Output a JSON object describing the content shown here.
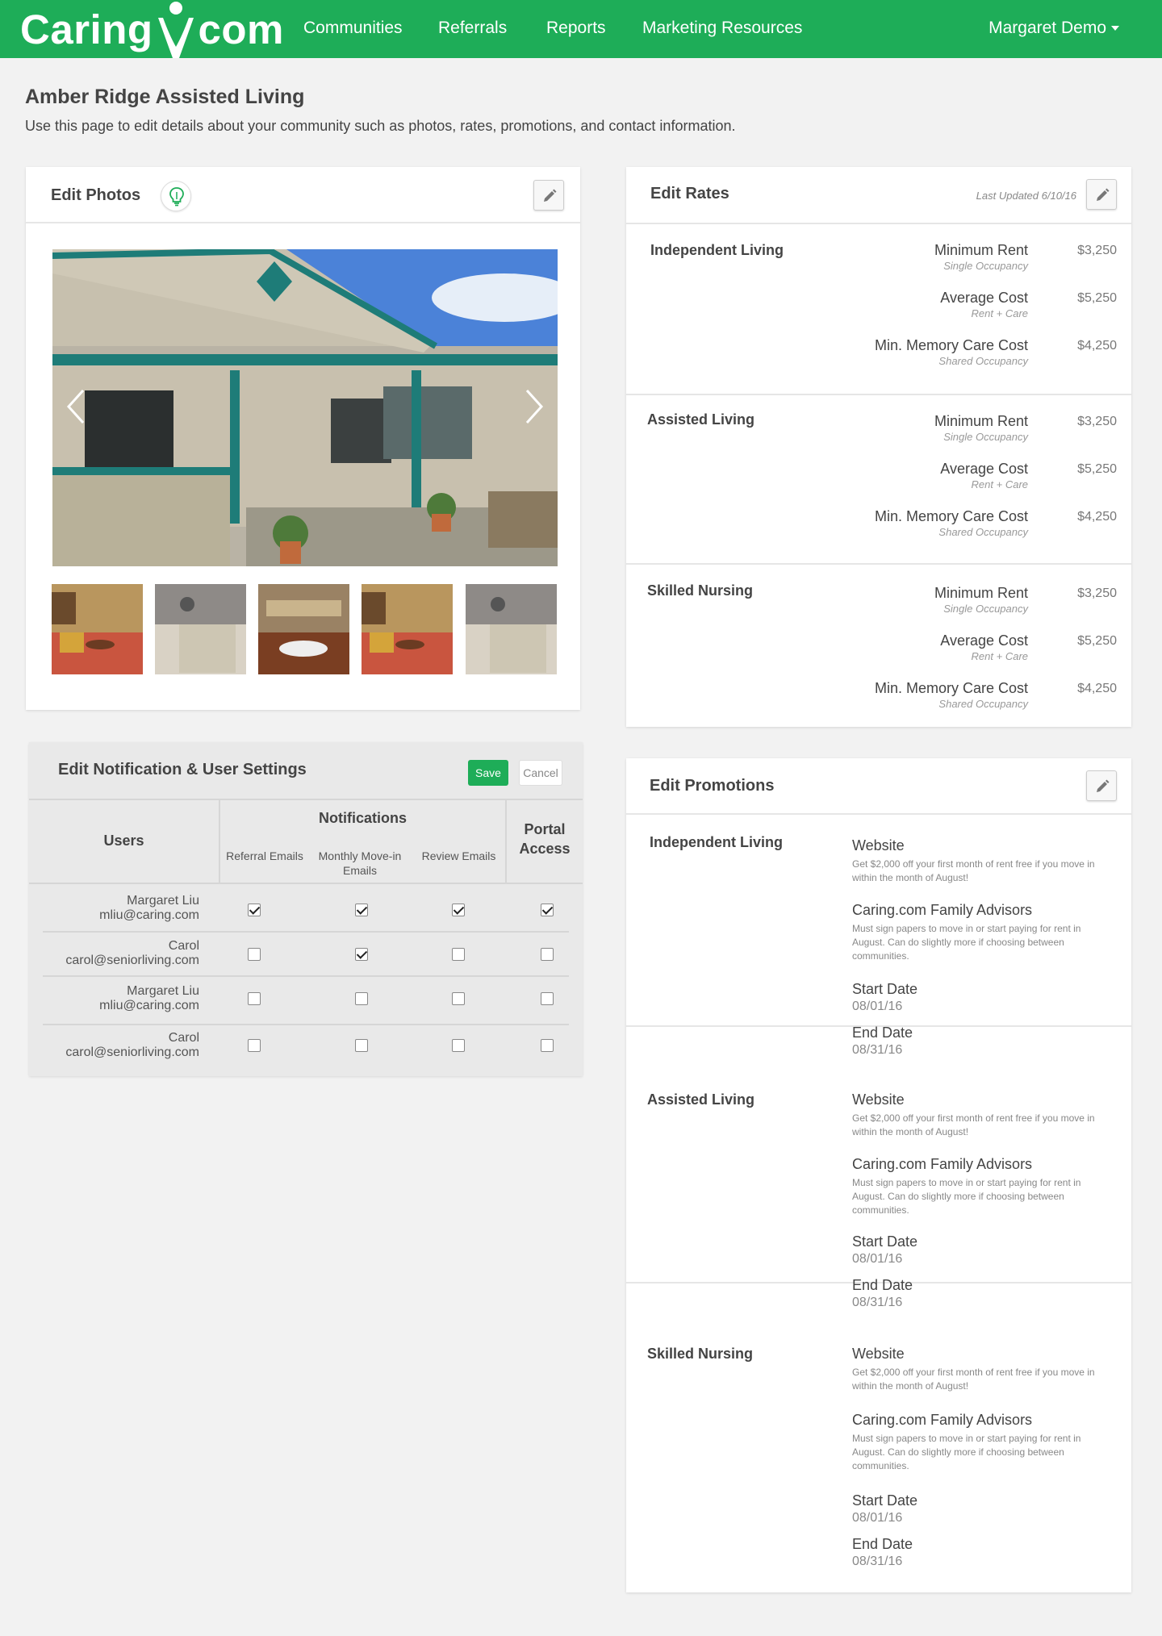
{
  "nav": {
    "logo_left": "Caring",
    "logo_right": "com",
    "links": [
      "Communities",
      "Referrals",
      "Reports",
      "Marketing Resources"
    ],
    "user": "Margaret Demo"
  },
  "page": {
    "title": "Amber Ridge Assisted Living",
    "description": "Use this page to edit details about your community such as photos, rates, promotions, and contact information."
  },
  "photos": {
    "title": "Edit Photos",
    "thumbnail_count": 5
  },
  "rates": {
    "title": "Edit Rates",
    "last_updated": "Last Updated 6/10/16",
    "sections": [
      {
        "category": "Independent Living",
        "rows": [
          {
            "label": "Minimum Rent",
            "sub": "Single Occupancy",
            "value": "$3,250"
          },
          {
            "label": "Average Cost",
            "sub": "Rent + Care",
            "value": "$5,250"
          },
          {
            "label": "Min. Memory Care Cost",
            "sub": "Shared Occupancy",
            "value": "$4,250"
          }
        ]
      },
      {
        "category": "Assisted Living",
        "rows": [
          {
            "label": "Minimum Rent",
            "sub": "Single Occupancy",
            "value": "$3,250"
          },
          {
            "label": "Average Cost",
            "sub": "Rent + Care",
            "value": "$5,250"
          },
          {
            "label": "Min. Memory Care Cost",
            "sub": "Shared Occupancy",
            "value": "$4,250"
          }
        ]
      },
      {
        "category": "Skilled Nursing",
        "rows": [
          {
            "label": "Minimum Rent",
            "sub": "Single Occupancy",
            "value": "$3,250"
          },
          {
            "label": "Average Cost",
            "sub": "Rent + Care",
            "value": "$5,250"
          },
          {
            "label": "Min. Memory Care Cost",
            "sub": "Shared Occupancy",
            "value": "$4,250"
          }
        ]
      }
    ]
  },
  "notifications": {
    "title": "Edit Notification & User Settings",
    "save_label": "Save",
    "cancel_label": "Cancel",
    "col_users": "Users",
    "col_notifications": "Notifications",
    "col_referral": "Referral Emails",
    "col_monthly_1": "Monthly Move-in",
    "col_monthly_2": "Emails",
    "col_review": "Review Emails",
    "col_portal_1": "Portal",
    "col_portal_2": "Access",
    "users": [
      {
        "name": "Margaret Liu",
        "email": "mliu@caring.com",
        "checks": [
          true,
          true,
          true,
          true
        ]
      },
      {
        "name": "Carol",
        "email": "carol@seniorliving.com",
        "checks": [
          false,
          true,
          false,
          false
        ]
      },
      {
        "name": "Margaret Liu",
        "email": "mliu@caring.com",
        "checks": [
          false,
          false,
          false,
          false
        ]
      },
      {
        "name": "Carol",
        "email": "carol@seniorliving.com",
        "checks": [
          false,
          false,
          false,
          false
        ]
      }
    ]
  },
  "promotions": {
    "title": "Edit Promotions",
    "sections": [
      {
        "category": "Independent Living",
        "website_label": "Website",
        "website_text": "Get $2,000 off your first month of rent free if you move in within the month of August!",
        "advisors_label": "Caring.com Family Advisors",
        "advisors_text": "Must sign papers to move in or start paying for rent in August. Can do slightly more if choosing between communities.",
        "start_label": "Start Date",
        "start_value": "08/01/16",
        "end_label": "End Date",
        "end_value": "08/31/16"
      },
      {
        "category": "Assisted Living",
        "website_label": "Website",
        "website_text": "Get $2,000 off your first month of rent free if you move in within the month of August!",
        "advisors_label": "Caring.com Family Advisors",
        "advisors_text": "Must sign papers to move in or start paying for rent in August. Can do slightly more if choosing between communities.",
        "start_label": "Start Date",
        "start_value": "08/01/16",
        "end_label": "End Date",
        "end_value": "08/31/16"
      },
      {
        "category": "Skilled Nursing",
        "website_label": "Website",
        "website_text": "Get $2,000 off your first month of rent free if you move in within the month of August!",
        "advisors_label": "Caring.com Family Advisors",
        "advisors_text": "Must sign papers to move in or start paying for rent in August. Can do slightly more if choosing between communities.",
        "start_label": "Start Date",
        "start_value": "08/01/16",
        "end_label": "End Date",
        "end_value": "08/31/16"
      }
    ]
  },
  "colors": {
    "brand": "#1ead58",
    "background": "#f2f2f2"
  }
}
